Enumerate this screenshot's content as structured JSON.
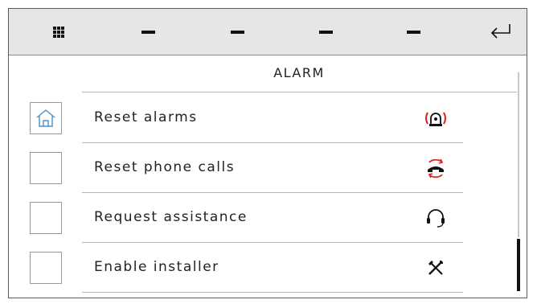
{
  "topbar": {
    "menu_icon": "grid-menu-icon",
    "slots": [
      "dash-icon",
      "dash-icon",
      "dash-icon",
      "dash-icon"
    ],
    "back_icon": "return-arrow-icon"
  },
  "page": {
    "title": "ALARM"
  },
  "items": [
    {
      "label": "Reset alarms",
      "left_icon": "home-icon",
      "right_icon": "alarm-beacon-icon"
    },
    {
      "label": "Reset phone calls",
      "left_icon": "",
      "right_icon": "phone-reset-icon"
    },
    {
      "label": "Request assistance",
      "left_icon": "",
      "right_icon": "headset-icon"
    },
    {
      "label": "Enable installer",
      "left_icon": "",
      "right_icon": "tools-icon"
    }
  ],
  "colors": {
    "accent_blue": "#4a90c8",
    "alert_red": "#e0201a",
    "topbar_bg": "#e6e6e6"
  }
}
